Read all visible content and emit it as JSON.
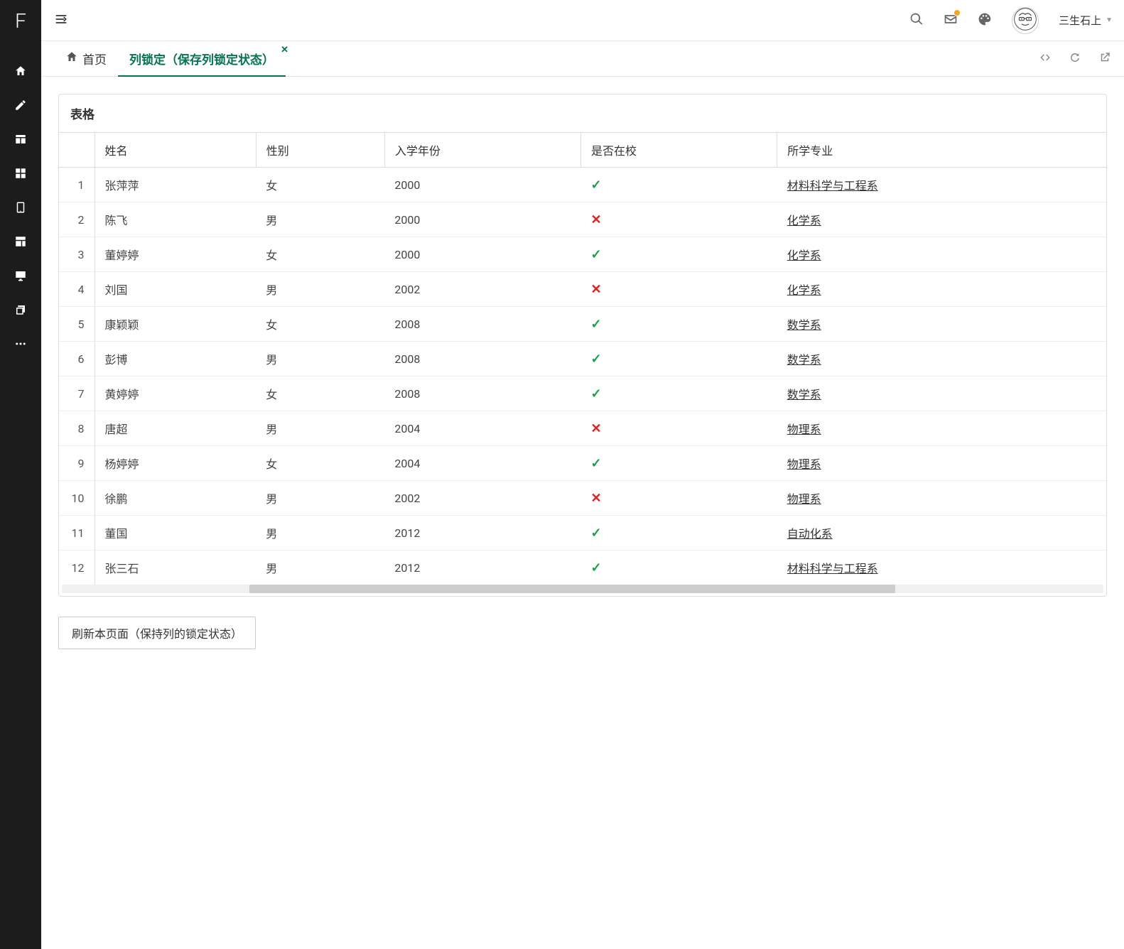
{
  "logo_letter": "F",
  "header": {
    "user_name": "三生石上"
  },
  "tabs": {
    "home_label": "首页",
    "active_label": "列锁定（保存列锁定状态）"
  },
  "panel": {
    "title": "表格"
  },
  "columns": {
    "name": "姓名",
    "gender": "性别",
    "year": "入学年份",
    "inschool": "是否在校",
    "major": "所学专业"
  },
  "rows": [
    {
      "idx": "1",
      "name": "张萍萍",
      "gender": "女",
      "year": "2000",
      "inschool": true,
      "major": "材料科学与工程系"
    },
    {
      "idx": "2",
      "name": "陈飞",
      "gender": "男",
      "year": "2000",
      "inschool": false,
      "major": "化学系"
    },
    {
      "idx": "3",
      "name": "董婷婷",
      "gender": "女",
      "year": "2000",
      "inschool": true,
      "major": "化学系"
    },
    {
      "idx": "4",
      "name": "刘国",
      "gender": "男",
      "year": "2002",
      "inschool": false,
      "major": "化学系"
    },
    {
      "idx": "5",
      "name": "康颖颖",
      "gender": "女",
      "year": "2008",
      "inschool": true,
      "major": "数学系"
    },
    {
      "idx": "6",
      "name": "彭博",
      "gender": "男",
      "year": "2008",
      "inschool": true,
      "major": "数学系"
    },
    {
      "idx": "7",
      "name": "黄婷婷",
      "gender": "女",
      "year": "2008",
      "inschool": true,
      "major": "数学系"
    },
    {
      "idx": "8",
      "name": "唐超",
      "gender": "男",
      "year": "2004",
      "inschool": false,
      "major": "物理系"
    },
    {
      "idx": "9",
      "name": "杨婷婷",
      "gender": "女",
      "year": "2004",
      "inschool": true,
      "major": "物理系"
    },
    {
      "idx": "10",
      "name": "徐鹏",
      "gender": "男",
      "year": "2002",
      "inschool": false,
      "major": "物理系"
    },
    {
      "idx": "11",
      "name": "董国",
      "gender": "男",
      "year": "2012",
      "inschool": true,
      "major": "自动化系"
    },
    {
      "idx": "12",
      "name": "张三石",
      "gender": "男",
      "year": "2012",
      "inschool": true,
      "major": "材料科学与工程系"
    }
  ],
  "refresh_button": "刷新本页面（保持列的锁定状态）"
}
